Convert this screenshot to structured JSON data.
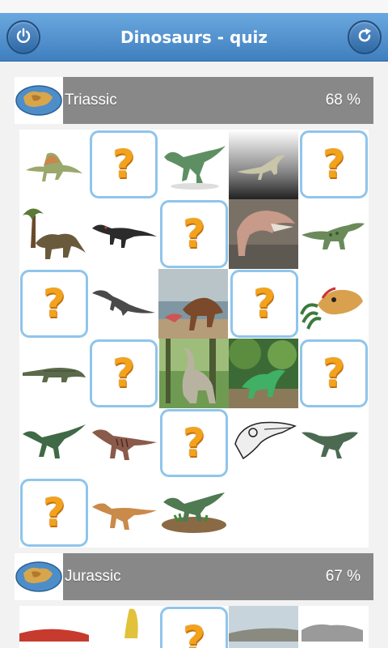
{
  "app": {
    "title": "Dinosaurs - quiz",
    "power_icon": "power-icon",
    "refresh_icon": "refresh-icon"
  },
  "sections": [
    {
      "era": "Triassic",
      "percent": "68 %",
      "icon": "globe-map-icon"
    },
    {
      "era": "Jurassic",
      "percent": "67 %",
      "icon": "globe-map-icon"
    }
  ],
  "tiles": {
    "question_mark": "?",
    "triassic_grid": [
      [
        "spinosaurus",
        "unknown",
        "theropod-green",
        "prosauropod-gradient",
        "unknown"
      ],
      [
        "plant-eater-trees",
        "theropod-dark",
        "unknown",
        "dino-head-photo",
        "theropod-spotted"
      ],
      [
        "unknown",
        "theropod-grey",
        "beach-photo",
        "unknown",
        "crested-head"
      ],
      [
        "phytosaur",
        "unknown",
        "forest-photo-1",
        "forest-photo-2",
        "unknown"
      ],
      [
        "theropod-slim",
        "theropod-striped",
        "unknown",
        "skull-sketch",
        "theropod-small"
      ],
      [
        "unknown",
        "theropod-orange",
        "theropod-on-ground"
      ]
    ],
    "jurassic_preview": [
      "red-dino",
      "yellow-dino",
      "unknown",
      "grey-dino",
      "grey-dino-2"
    ]
  },
  "colors": {
    "header_top": "#6aa8df",
    "header_bottom": "#3f7fbf",
    "bar": "#888888",
    "tile_border": "#8fc5eb",
    "question_mark": "#f3a21b"
  }
}
